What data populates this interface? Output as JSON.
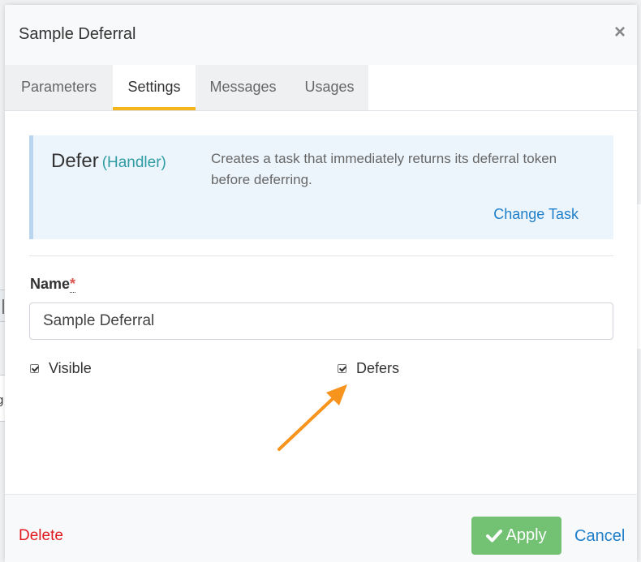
{
  "dialog": {
    "title": "Sample Deferral",
    "close_icon": "close-icon"
  },
  "tabs": [
    {
      "label": "Parameters",
      "active": false
    },
    {
      "label": "Settings",
      "active": true
    },
    {
      "label": "Messages",
      "active": false
    },
    {
      "label": "Usages",
      "active": false
    }
  ],
  "task": {
    "name": "Defer",
    "type": "(Handler)",
    "description": "Creates a task that immediately returns its deferral token before deferring.",
    "change_label": "Change Task"
  },
  "form": {
    "name_label": "Name",
    "required_mark": "*",
    "name_value": "Sample Deferral",
    "visible_label": "Visible",
    "visible_checked": true,
    "defers_label": "Defers",
    "defers_checked": true
  },
  "footer": {
    "delete_label": "Delete",
    "apply_label": "Apply",
    "cancel_label": "Cancel"
  },
  "background": {
    "edge_text": "g"
  },
  "colors": {
    "accent_tab": "#f5b51d",
    "link": "#1f7fc9",
    "delete": "#e0191f",
    "apply": "#5cb85c",
    "task_type": "#2f9ca3",
    "annotation_arrow": "#f7941d"
  }
}
